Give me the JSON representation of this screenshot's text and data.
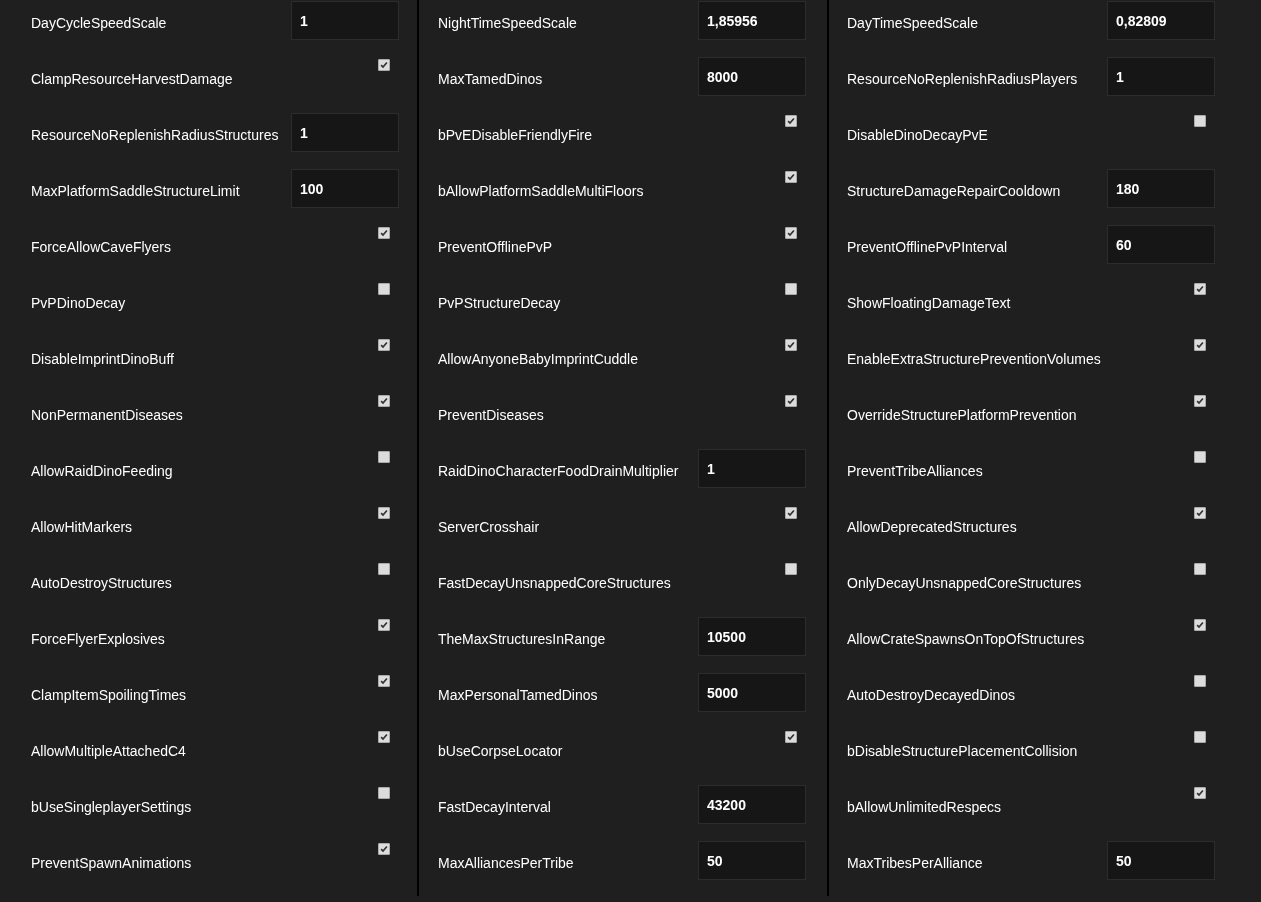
{
  "columns": [
    {
      "settings": [
        {
          "label": "DayCycleSpeedScale",
          "kind": "number",
          "value": "1"
        },
        {
          "label": "ClampResourceHarvestDamage",
          "kind": "checkbox",
          "checked": true
        },
        {
          "label": "ResourceNoReplenishRadiusStructures",
          "kind": "number",
          "value": "1"
        },
        {
          "label": "MaxPlatformSaddleStructureLimit",
          "kind": "number",
          "value": "100"
        },
        {
          "label": "ForceAllowCaveFlyers",
          "kind": "checkbox",
          "checked": true
        },
        {
          "label": "PvPDinoDecay",
          "kind": "checkbox",
          "checked": false
        },
        {
          "label": "DisableImprintDinoBuff",
          "kind": "checkbox",
          "checked": true
        },
        {
          "label": "NonPermanentDiseases",
          "kind": "checkbox",
          "checked": true
        },
        {
          "label": "AllowRaidDinoFeeding",
          "kind": "checkbox",
          "checked": false
        },
        {
          "label": "AllowHitMarkers",
          "kind": "checkbox",
          "checked": true
        },
        {
          "label": "AutoDestroyStructures",
          "kind": "checkbox",
          "checked": false
        },
        {
          "label": "ForceFlyerExplosives",
          "kind": "checkbox",
          "checked": true
        },
        {
          "label": "ClampItemSpoilingTimes",
          "kind": "checkbox",
          "checked": true
        },
        {
          "label": "AllowMultipleAttachedC4",
          "kind": "checkbox",
          "checked": true
        },
        {
          "label": "bUseSingleplayerSettings",
          "kind": "checkbox",
          "checked": false
        },
        {
          "label": "PreventSpawnAnimations",
          "kind": "checkbox",
          "checked": true
        }
      ]
    },
    {
      "settings": [
        {
          "label": "NightTimeSpeedScale",
          "kind": "number",
          "value": "1,85956"
        },
        {
          "label": "MaxTamedDinos",
          "kind": "number",
          "value": "8000"
        },
        {
          "label": "bPvEDisableFriendlyFire",
          "kind": "checkbox",
          "checked": true
        },
        {
          "label": "bAllowPlatformSaddleMultiFloors",
          "kind": "checkbox",
          "checked": true
        },
        {
          "label": "PreventOfflinePvP",
          "kind": "checkbox",
          "checked": true
        },
        {
          "label": "PvPStructureDecay",
          "kind": "checkbox",
          "checked": false
        },
        {
          "label": "AllowAnyoneBabyImprintCuddle",
          "kind": "checkbox",
          "checked": true
        },
        {
          "label": "PreventDiseases",
          "kind": "checkbox",
          "checked": true
        },
        {
          "label": "RaidDinoCharacterFoodDrainMultiplier",
          "kind": "number",
          "value": "1"
        },
        {
          "label": "ServerCrosshair",
          "kind": "checkbox",
          "checked": true
        },
        {
          "label": "FastDecayUnsnappedCoreStructures",
          "kind": "checkbox",
          "checked": false
        },
        {
          "label": "TheMaxStructuresInRange",
          "kind": "number",
          "value": "10500"
        },
        {
          "label": "MaxPersonalTamedDinos",
          "kind": "number",
          "value": "5000"
        },
        {
          "label": "bUseCorpseLocator",
          "kind": "checkbox",
          "checked": true
        },
        {
          "label": "FastDecayInterval",
          "kind": "number",
          "value": "43200"
        },
        {
          "label": "MaxAlliancesPerTribe",
          "kind": "number",
          "value": "50"
        }
      ]
    },
    {
      "settings": [
        {
          "label": "DayTimeSpeedScale",
          "kind": "number",
          "value": "0,82809"
        },
        {
          "label": "ResourceNoReplenishRadiusPlayers",
          "kind": "number",
          "value": "1"
        },
        {
          "label": "DisableDinoDecayPvE",
          "kind": "checkbox",
          "checked": false
        },
        {
          "label": "StructureDamageRepairCooldown",
          "kind": "number",
          "value": "180"
        },
        {
          "label": "PreventOfflinePvPInterval",
          "kind": "number",
          "value": "60"
        },
        {
          "label": "ShowFloatingDamageText",
          "kind": "checkbox",
          "checked": true
        },
        {
          "label": "EnableExtraStructurePreventionVolumes",
          "kind": "checkbox",
          "checked": true
        },
        {
          "label": "OverrideStructurePlatformPrevention",
          "kind": "checkbox",
          "checked": true
        },
        {
          "label": "PreventTribeAlliances",
          "kind": "checkbox",
          "checked": false
        },
        {
          "label": "AllowDeprecatedStructures",
          "kind": "checkbox",
          "checked": true
        },
        {
          "label": "OnlyDecayUnsnappedCoreStructures",
          "kind": "checkbox",
          "checked": false
        },
        {
          "label": "AllowCrateSpawnsOnTopOfStructures",
          "kind": "checkbox",
          "checked": true
        },
        {
          "label": "AutoDestroyDecayedDinos",
          "kind": "checkbox",
          "checked": false
        },
        {
          "label": "bDisableStructurePlacementCollision",
          "kind": "checkbox",
          "checked": false
        },
        {
          "label": "bAllowUnlimitedRespecs",
          "kind": "checkbox",
          "checked": true
        },
        {
          "label": "MaxTribesPerAlliance",
          "kind": "number",
          "value": "50"
        }
      ]
    }
  ]
}
